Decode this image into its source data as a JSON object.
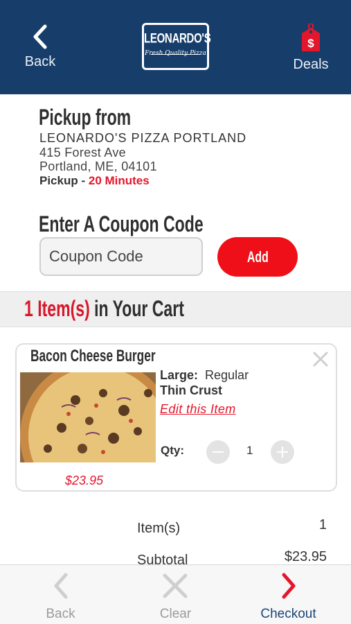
{
  "header": {
    "back_label": "Back",
    "deals_label": "Deals",
    "logo_name": "LEONARDO'S",
    "logo_tagline": "Fresh Quality Pizza"
  },
  "pickup": {
    "title": "Pickup from",
    "store_name": "LEONARDO'S PIZZA PORTLAND",
    "address_line1": "415 Forest Ave",
    "address_line2": "Portland, ME, 04101",
    "pickup_label": "Pickup - ",
    "pickup_time": "20 Minutes"
  },
  "coupon": {
    "title": "Enter A Coupon Code",
    "placeholder": "Coupon Code",
    "add_label": "Add"
  },
  "cart": {
    "count_text": "1 Item(s)",
    "suffix_text": " in Your Cart"
  },
  "item": {
    "name": "Bacon Cheese Burger",
    "size_label": "Large:",
    "size_value": "Regular",
    "crust": "Thin Crust",
    "edit_label": "Edit this Item",
    "qty_label": "Qty:",
    "qty_value": "1",
    "price": "$23.95"
  },
  "summary": {
    "items_label": "Item(s)",
    "items_value": "1",
    "subtotal_label": "Subtotal",
    "subtotal_value": "$23.95"
  },
  "bottom_bar": {
    "back_label": "Back",
    "clear_label": "Clear",
    "checkout_label": "Checkout"
  },
  "colors": {
    "header_bg": "#173e6b",
    "accent_red": "#e4162b",
    "checkout_blue": "#1c4575"
  }
}
